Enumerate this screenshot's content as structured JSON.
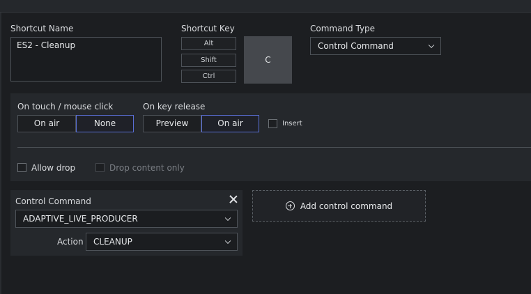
{
  "shortcut": {
    "name_label": "Shortcut Name",
    "name_value": "ES2 - Cleanup",
    "key_label": "Shortcut Key",
    "modifiers": [
      "Alt",
      "Shift",
      "Ctrl"
    ],
    "main_key": "C",
    "command_type_label": "Command Type",
    "command_type_value": "Control Command"
  },
  "triggers": {
    "touch_label": "On touch / mouse click",
    "touch_options": [
      "On air",
      "None"
    ],
    "touch_selected": "None",
    "release_label": "On key release",
    "release_options": [
      "Preview",
      "On air"
    ],
    "release_selected": "On air",
    "insert_label": "Insert",
    "allow_drop_label": "Allow drop",
    "drop_content_only_label": "Drop content only"
  },
  "control_command": {
    "title": "Control Command",
    "command_value": "ADAPTIVE_LIVE_PRODUCER",
    "action_label": "Action",
    "action_value": "CLEANUP",
    "add_label": "Add control command"
  },
  "colors": {
    "background": "#1c1e21",
    "panel": "#25282c",
    "accent_border": "#5a6fd6"
  }
}
